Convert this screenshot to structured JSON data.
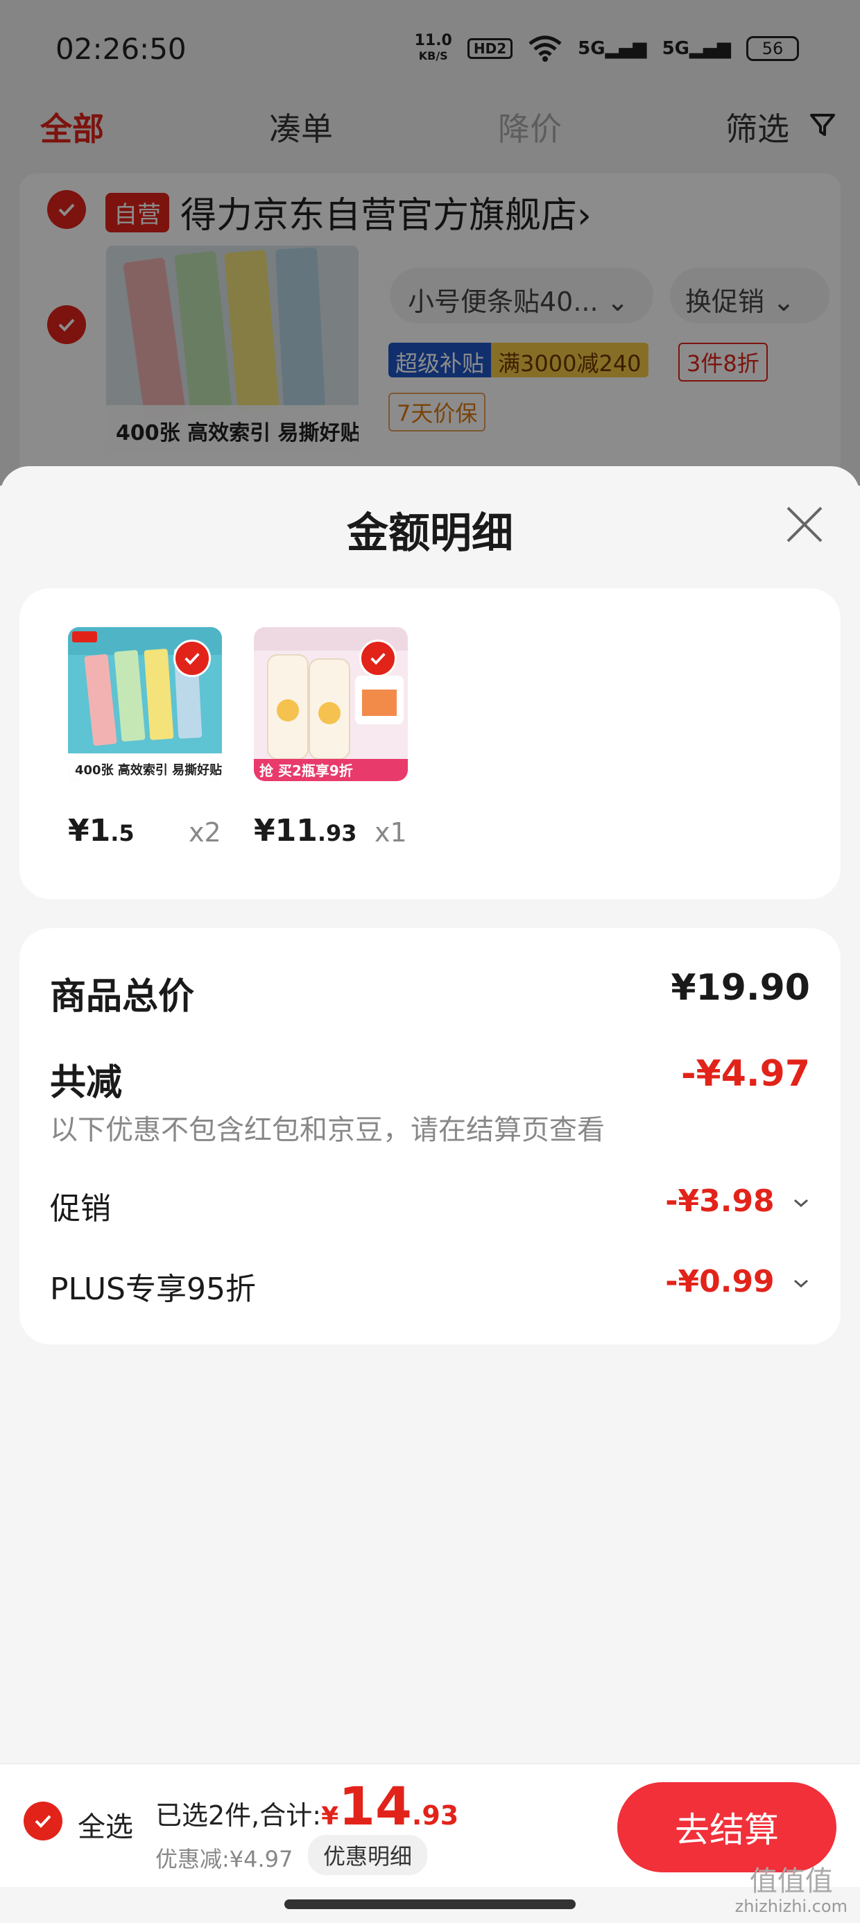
{
  "status_bar": {
    "time": "02:26:50",
    "net_speed_value": "11.0",
    "net_speed_unit": "KB/S",
    "hd_label": "HD2",
    "signal_1": "5G",
    "signal_2": "5G",
    "battery": "56"
  },
  "tabs": [
    {
      "label": "全部",
      "active": true
    },
    {
      "label": "凑单",
      "active": false
    },
    {
      "label": "降价",
      "active": false
    },
    {
      "label": "筛选",
      "active": false
    }
  ],
  "store": {
    "badge": "自营",
    "name": "得力京东自营官方旗舰店",
    "chevron": "›",
    "product": {
      "thumb_caption": "400张 高效索引 易撕好贴",
      "spec": "小号便条贴40...",
      "promo_switch": "换促销",
      "tag_super_a": "超级补贴",
      "tag_super_b": "满3000减240",
      "tag_discount": "3件8折",
      "tag_price_protect": "7天价保"
    }
  },
  "sheet": {
    "title": "金额明细",
    "goods": [
      {
        "price_int": "¥1",
        "price_dec": ".5",
        "qty": "x2",
        "img_caption": "400张 高效索引 易撕好贴"
      },
      {
        "price_int": "¥11",
        "price_dec": ".93",
        "qty": "x1",
        "img_caption": "抢 买2瓶享9折"
      }
    ],
    "summary": {
      "total_label": "商品总价",
      "total_value": "¥19.90",
      "reduce_label": "共减",
      "reduce_value": "-¥4.97",
      "reduce_note": "以下优惠不包含红包和京豆，请在结算页查看",
      "promo_label": "促销",
      "promo_value": "-¥3.98",
      "plus_label": "PLUS专享95折",
      "plus_value": "-¥0.99"
    }
  },
  "bottom_bar": {
    "select_all": "全选",
    "selected_text": "已选2件,合计:",
    "total_yen": "¥",
    "total_int": "14",
    "total_dec": ".93",
    "discount_text": "优惠减:¥4.97",
    "detail_button": "优惠明细",
    "checkout_button": "去结算"
  },
  "watermark": {
    "line1": "值值值",
    "line2": "zhizhizhi.com"
  },
  "colors": {
    "accent": "#e2231a",
    "checkout": "#f1303a"
  }
}
